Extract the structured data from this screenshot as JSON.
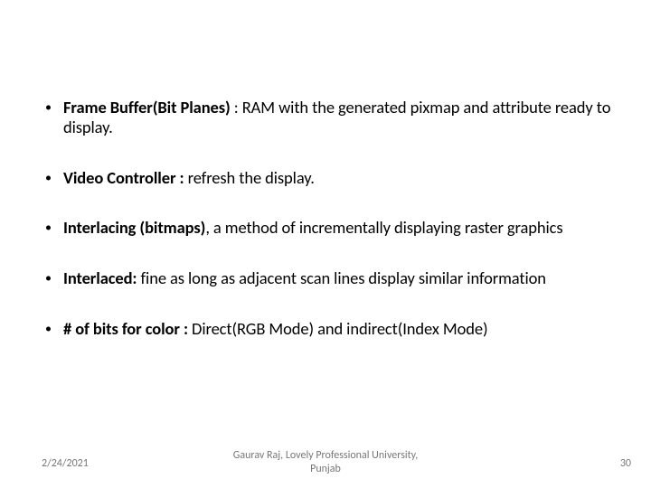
{
  "bullets": [
    {
      "bold": "Frame Buffer(Bit Planes) ",
      "rest": ": RAM with the generated pixmap and attribute ready to display."
    },
    {
      "bold": "Video  Controller : ",
      "rest": "refresh the display."
    },
    {
      "bold": "Interlacing (bitmaps)",
      "rest": ", a method of incrementally displaying raster graphics"
    },
    {
      "bold": "Interlaced: ",
      "rest": "fine as long as adjacent scan lines display similar information"
    },
    {
      "bold": "# of bits for color : ",
      "rest": "Direct(RGB Mode) and indirect(Index Mode)"
    }
  ],
  "footer": {
    "date": "2/24/2021",
    "center_line1": "Gaurav Raj, Lovely Professional University,",
    "center_line2": "Punjab",
    "page": "30"
  }
}
